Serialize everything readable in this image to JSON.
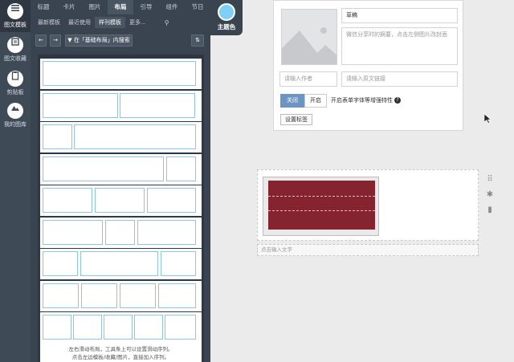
{
  "rail": {
    "items": [
      {
        "label": "图文模板",
        "icon": "list-icon"
      },
      {
        "label": "图文收藏",
        "icon": "folder-icon"
      },
      {
        "label": "剪贴板",
        "icon": "clipboard-icon"
      },
      {
        "label": "我的图库",
        "icon": "mountain-image-icon"
      }
    ]
  },
  "panel": {
    "tabs": [
      "标题",
      "卡片",
      "图片",
      "布局",
      "引导",
      "组件",
      "节日"
    ],
    "active_tab": "布局",
    "subtabs": [
      "最新模板",
      "最近使用",
      "样刊模板",
      "更多..."
    ],
    "active_subtab": "样刊模板",
    "search_scope_label": "在「基础布局」内搜索",
    "hint_line1": "左右滑动布局，工具条上可以设置滑动序列。",
    "hint_line2": "点击左边模板/收藏/图片，直接加入序列。"
  },
  "theme": {
    "label": "主题色",
    "color": "#7fd0f7"
  },
  "editor": {
    "title_value": "草稿",
    "summary_placeholder": "微信分享时的摘要，点击左侧图片改封面",
    "author_placeholder": "请输入作者",
    "link_placeholder": "请输入原文链接",
    "toggle_off_label": "关闭",
    "toggle_on_label": "开启",
    "enhance_label": "开启表单字体等增强特性",
    "tags_button_label": "设置标签"
  },
  "canvas": {
    "caption_placeholder": "点击输入文字",
    "banner_color": "#85232f"
  }
}
